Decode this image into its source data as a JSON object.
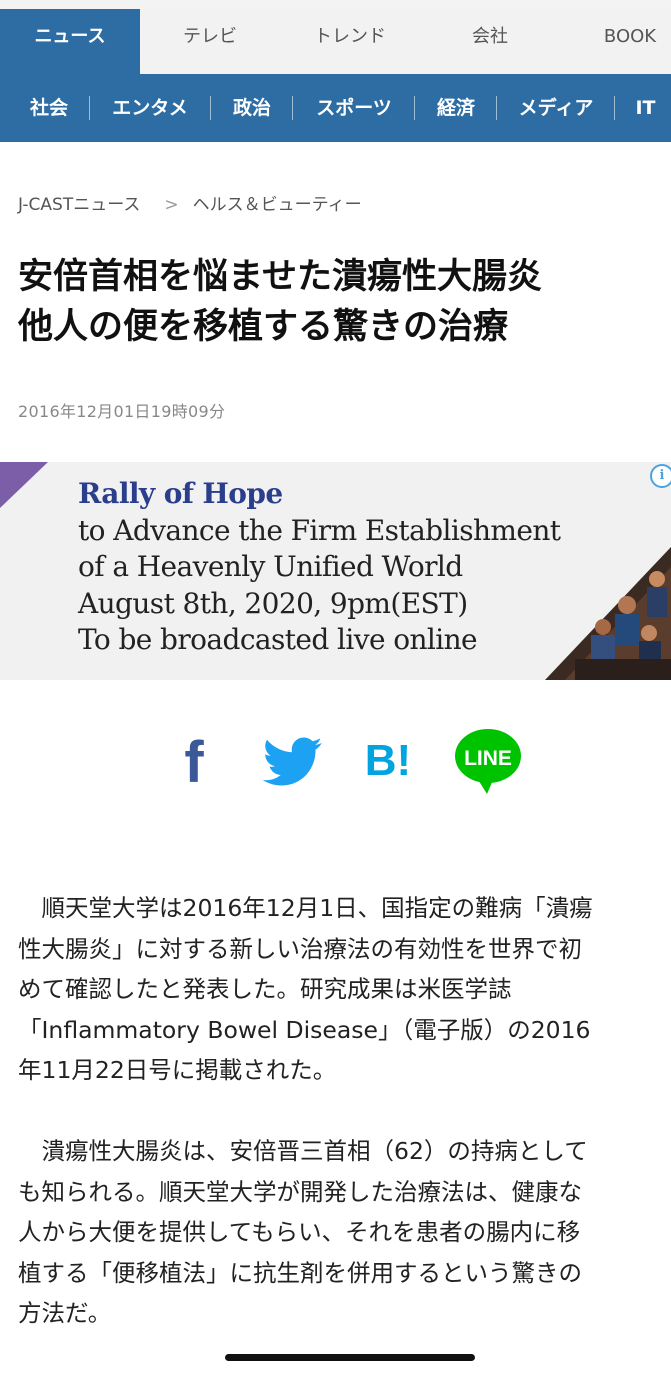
{
  "top_tabs": [
    "ニュース",
    "テレビ",
    "トレンド",
    "会社",
    "BOOK"
  ],
  "categories": [
    "社会",
    "エンタメ",
    "政治",
    "スポーツ",
    "経済",
    "メディア",
    "IT"
  ],
  "breadcrumb": {
    "site": "J-CASTニュース",
    "separator": ">",
    "section": "ヘルス＆ビューティー"
  },
  "article": {
    "title_line1": "安倍首相を悩ませた潰瘍性大腸炎",
    "title_line2": "他人の便を移植する驚きの治療",
    "date": "2016年12月01日19時09分",
    "paragraph1": [
      "　順天堂大学は2016年12月1日、国指定の難病「潰瘍",
      "性大腸炎」に対する新しい治療法の有効性を世界で初",
      "めて確認したと発表した。研究成果は米医学誌",
      "「Inflammatory Bowel Disease」（電子版）の2016",
      "年11月22日号に掲載された。"
    ],
    "paragraph2": [
      "　潰瘍性大腸炎は、安倍晋三首相（62）の持病として",
      "も知られる。順天堂大学が開発した治療法は、健康な",
      "人から大便を提供してもらい、それを患者の腸内に移",
      "植する「便移植法」に抗生剤を併用するという驚きの",
      "方法だ。"
    ]
  },
  "ad": {
    "lines": [
      "Rally of Hope",
      "to Advance the Firm Establishment",
      "of a Heavenly Unified World",
      "August 8th, 2020, 9pm(EST)",
      "To be broadcasted live online"
    ],
    "info_glyph": "i"
  },
  "share": {
    "facebook_glyph": "f",
    "hatena_glyph": "B!",
    "line_label": "LINE"
  },
  "colors": {
    "brand_blue": "#2e6da4",
    "facebook": "#3b5998",
    "twitter": "#1da1f2",
    "hatena": "#00a4de",
    "line": "#00c300"
  }
}
